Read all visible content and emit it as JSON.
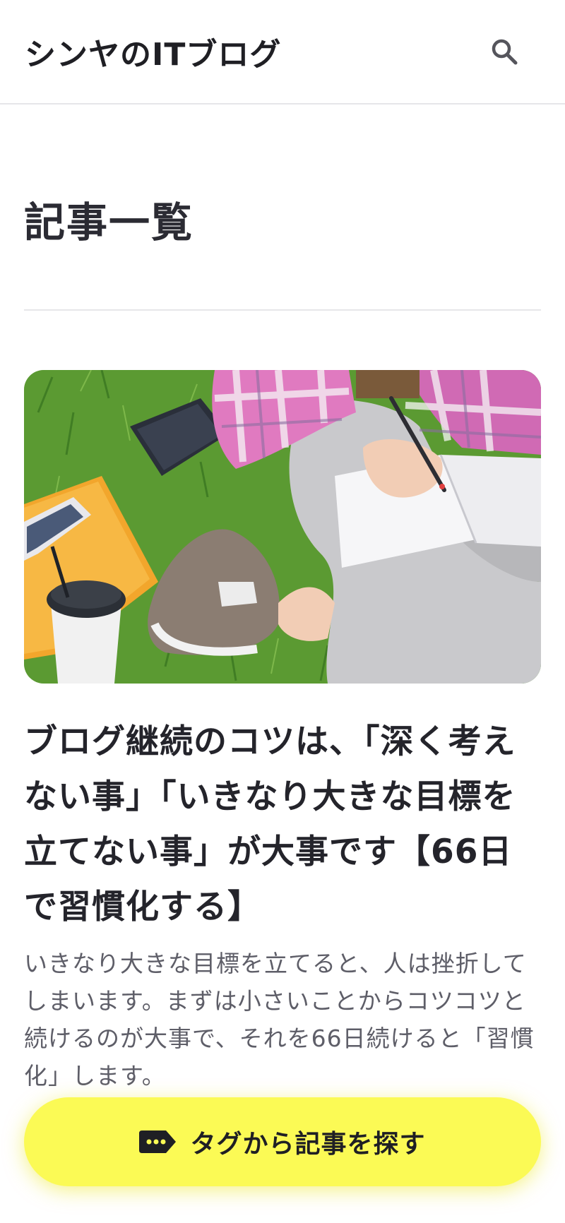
{
  "header": {
    "site_title": "シンヤのITブログ",
    "search_icon": "search-icon"
  },
  "main": {
    "heading": "記事一覧",
    "articles": [
      {
        "title": "ブログ継続のコツは、「深く考えない事」「いきなり大きな目標を立てない事」が大事です【66日で習慣化する】",
        "excerpt": "いきなり大きな目標を立てると、人は挫折してしまいます。まずは小さいことからコツコツと続けるのが大事で、それを66日続けると「習慣化」します。"
      }
    ]
  },
  "fab": {
    "label": "タグから記事を探す",
    "icon": "tag-icon",
    "color": "#fbfa55"
  }
}
